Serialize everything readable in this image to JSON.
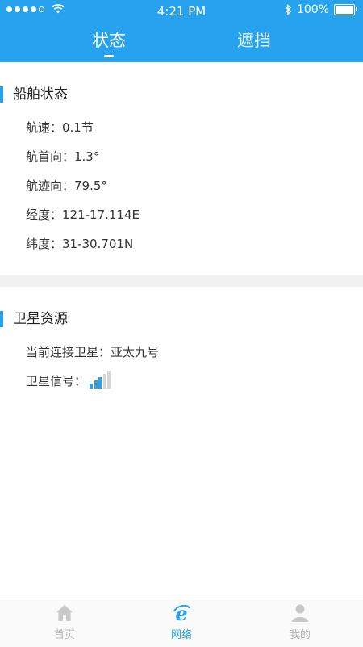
{
  "status_bar": {
    "time": "4:21 PM",
    "battery": "100%"
  },
  "tabs": [
    {
      "label": "状态",
      "active": true
    },
    {
      "label": "遮挡",
      "active": false
    }
  ],
  "ship_status": {
    "title": "船舶状态",
    "rows": [
      {
        "text": "航速：0.1节"
      },
      {
        "text": "航首向：1.3°"
      },
      {
        "text": "航迹向：79.5°"
      },
      {
        "text": "经度：121-17.114E"
      },
      {
        "text": "纬度：31-30.701N"
      }
    ]
  },
  "satellite": {
    "title": "卫星资源",
    "connected_text": "当前连接卫星：亚太九号",
    "signal_label": "卫星信号：",
    "signal_level": 3,
    "signal_max": 5
  },
  "tabbar": {
    "items": [
      {
        "label": "首页",
        "icon": "home-icon",
        "active": false
      },
      {
        "label": "网络",
        "icon": "network-e-icon",
        "active": true
      },
      {
        "label": "我的",
        "icon": "profile-icon",
        "active": false
      }
    ]
  },
  "colors": {
    "accent": "#27a2ef",
    "inactive": "#b5b5b5"
  }
}
